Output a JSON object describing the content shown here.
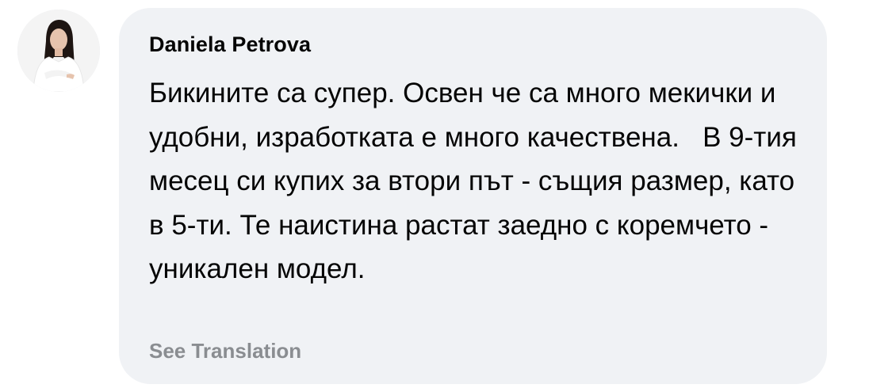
{
  "comment": {
    "author_name": "Daniela Petrova",
    "text": "Бикините са супер. Освен че са много мекички и удобни, изработката е много качествена.   В 9-тия месец си купих за втори път - същия размер, като в 5-ти. Те наистина растат заедно с коремчето - уникален модел.",
    "see_translation_label": "See Translation",
    "avatar_icon": "profile-photo-woman"
  },
  "colors": {
    "bubble_background": "#f0f2f5",
    "text": "#050505",
    "secondary_text": "#8a8d91"
  }
}
